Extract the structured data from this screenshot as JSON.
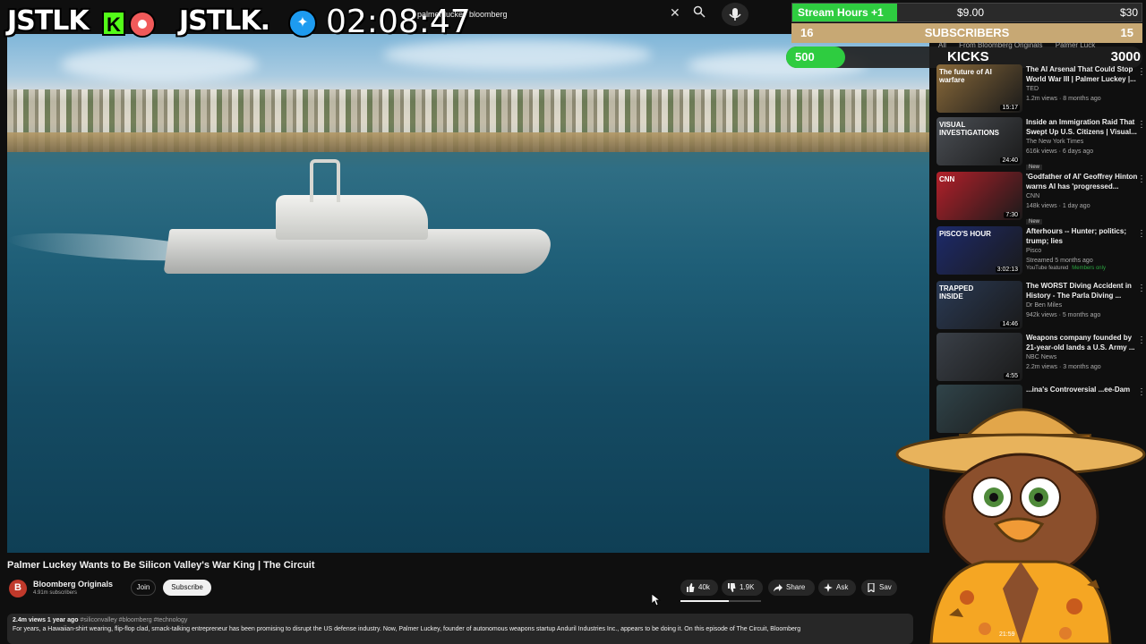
{
  "stream_overlay": {
    "brand_kick": "JSTLK",
    "kick_badge": "K",
    "brand_twitter": "JSTLK.",
    "timer": "02:08:47"
  },
  "search": {
    "query": "palmer luckey bloomberg",
    "clear_icon": "close-icon",
    "search_icon": "search-icon",
    "mic_icon": "mic-icon"
  },
  "goals": {
    "stream_hours": {
      "label": "Stream Hours +1",
      "mid": "$9.00",
      "max": "$30",
      "progress": 0.3,
      "color": "#2ecc40"
    },
    "subscribers": {
      "current": "16",
      "label": "SUBSCRIBERS",
      "target": "15",
      "color": "#c7a874"
    },
    "kicks": {
      "current": "500",
      "label": "KICKS",
      "max": "3000",
      "progress": 0.1667,
      "color": "#2ecc40"
    }
  },
  "sidebar": {
    "chips": [
      "All",
      "From Bloomberg Originals",
      "Palmer Luck"
    ],
    "items": [
      {
        "title": "The AI Arsenal That Could Stop World War III | Palmer Luckey |...",
        "channel": "TED",
        "stats": "1.2m views · 8 months ago",
        "duration": "15:17",
        "thumb_tag": "The future of AI warfare",
        "thumb_color": "#8a6a3a",
        "badge": ""
      },
      {
        "title": "Inside an Immigration Raid That Swept Up U.S. Citizens | Visual...",
        "channel": "The New York Times",
        "stats": "616k views · 6 days ago",
        "duration": "24:40",
        "thumb_tag": "VISUAL INVESTIGATIONS",
        "thumb_color": "#4b4f55",
        "badge": "New"
      },
      {
        "title": "'Godfather of AI' Geoffrey Hinton warns AI has 'progressed...",
        "channel": "CNN",
        "stats": "148k views · 1 day ago",
        "duration": "7:30",
        "thumb_tag": "CNN",
        "thumb_color": "#b3202a",
        "badge": "New"
      },
      {
        "title": "Afterhours -- Hunter; politics; trump; lies",
        "channel": "Pisco",
        "stats": "Streamed 5 months ago",
        "duration": "3:02:13",
        "thumb_tag": "PISCO'S HOUR",
        "thumb_color": "#1d2a6b",
        "badge": "YouTube featured",
        "badge2": "Members only"
      },
      {
        "title": "The WORST Diving Accident in History - The Parla Diving ...",
        "channel": "Dr Ben Miles",
        "stats": "942k views · 5 months ago",
        "duration": "14:46",
        "thumb_tag": "TRAPPED INSIDE",
        "thumb_color": "#2a3a55",
        "badge": ""
      },
      {
        "title": "Weapons company founded by 21-year-old lands a U.S. Army ...",
        "channel": "NBC News",
        "stats": "2.2m views · 3 months ago",
        "duration": "4:55",
        "thumb_tag": "",
        "thumb_color": "#3a4048",
        "badge": ""
      },
      {
        "title": "...ina's Controversial ...ee-Dam",
        "channel": "",
        "stats": "",
        "duration": "",
        "thumb_tag": "",
        "thumb_color": "#30444a",
        "badge": ""
      }
    ],
    "more_icon": "more-vert-icon"
  },
  "video": {
    "title": "Palmer Luckey Wants to Be Silicon Valley's War King | The Circuit",
    "channel": "Bloomberg Originals",
    "subscribers": "4.91m subscribers",
    "join_label": "Join",
    "subscribe_label": "Subscribe",
    "likes": "40k",
    "dislikes": "1.9K",
    "share_label": "Share",
    "ask_label": "Ask",
    "save_label": "Sav",
    "views_date": "2.4m views  1 year ago",
    "hashtags": "#siliconvalley #bloomberg #technology",
    "description": "For years, a Hawaiian-shirt wearing, flip-flop clad, smack-talking entrepreneur has been promising to disrupt the US defense industry. Now, Palmer Luckey, founder of autonomous weapons startup Anduril Industries Inc., appears to be doing it. On this episode of The Circuit, Bloomberg"
  },
  "mascot": {
    "timestamp": "21:59",
    "hat_color": "#e2a64a",
    "shirt_color": "#f5a623"
  }
}
